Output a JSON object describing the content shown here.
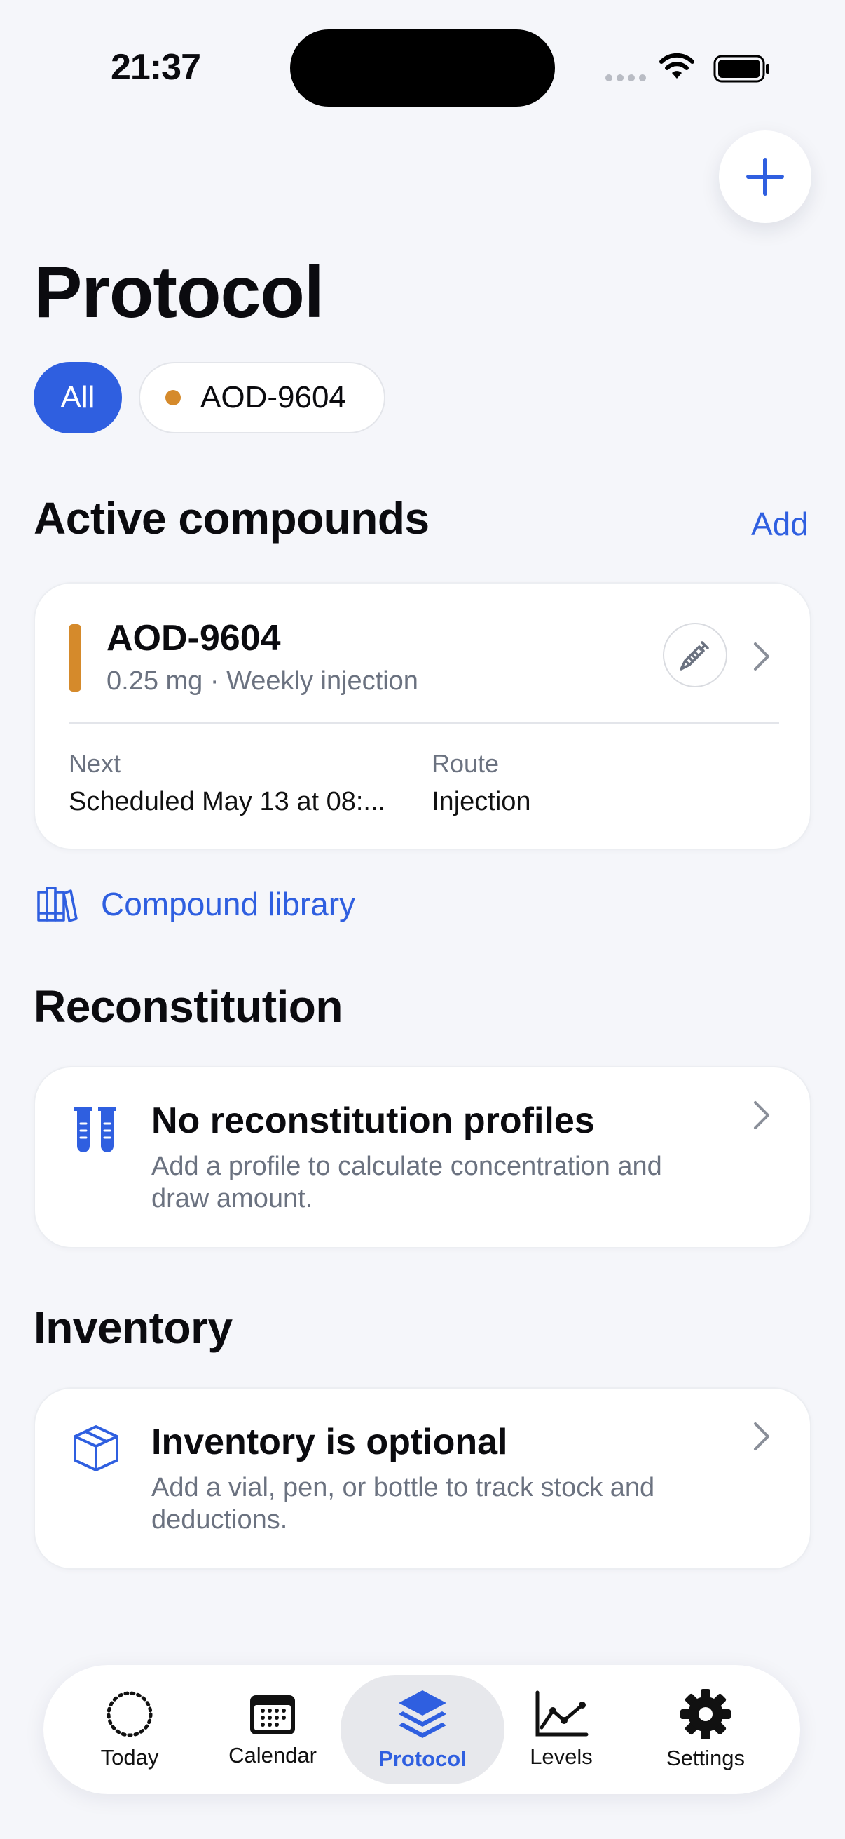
{
  "status_bar": {
    "time": "21:37"
  },
  "header": {
    "title": "Protocol",
    "add_button": "+"
  },
  "filters": {
    "all": "All",
    "compound": "AOD-9604"
  },
  "active_compounds": {
    "title": "Active compounds",
    "add_label": "Add",
    "items": [
      {
        "name": "AOD-9604",
        "summary": "0.25 mg · Weekly injection",
        "next_label": "Next",
        "next_value": "Scheduled May 13 at 08:...",
        "route_label": "Route",
        "route_value": "Injection",
        "color": "#d58a2b"
      }
    ],
    "library_link": "Compound library"
  },
  "reconstitution": {
    "title": "Reconstitution",
    "empty_title": "No reconstitution profiles",
    "empty_desc": "Add a profile to calculate concentration and draw amount."
  },
  "inventory": {
    "title": "Inventory",
    "empty_title": "Inventory is optional",
    "empty_desc": "Add a vial, pen, or bottle to track stock and deductions."
  },
  "tabbar": {
    "active": "Protocol",
    "tabs": [
      {
        "label": "Today",
        "icon": "dotted-circle-icon"
      },
      {
        "label": "Calendar",
        "icon": "calendar-icon"
      },
      {
        "label": "Protocol",
        "icon": "layers-icon"
      },
      {
        "label": "Levels",
        "icon": "line-chart-icon"
      },
      {
        "label": "Settings",
        "icon": "gear-icon"
      }
    ]
  },
  "colors": {
    "accent": "#2f5fe0",
    "compound": "#d58a2b",
    "background": "#f5f6fa"
  }
}
